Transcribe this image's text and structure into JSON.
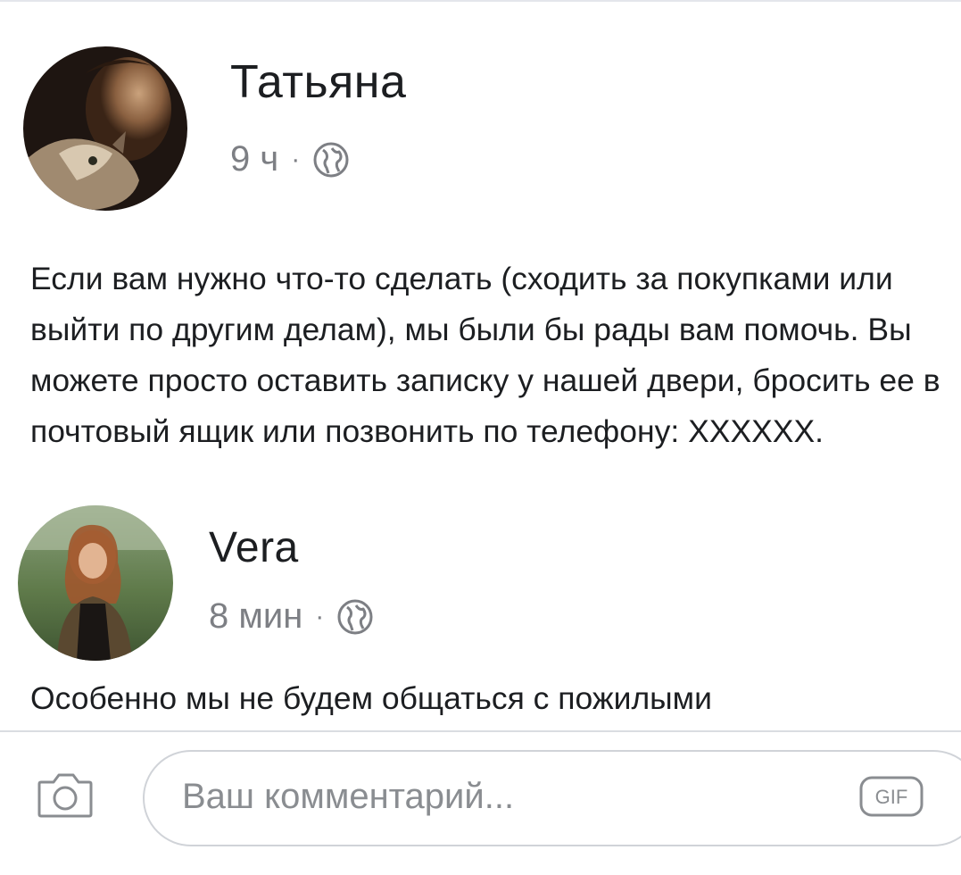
{
  "post": {
    "author": "Татьяна",
    "time": "9 ч",
    "separator": "·",
    "privacy_icon": "globe-icon",
    "text": "Если вам нужно что-то сделать (сходить за покупками или выйти по другим делам), мы были бы рады вам помочь. Вы можете просто оставить записку у нашей двери, бросить ее в почтовый ящик или позвонить по телефону: XXXXXX."
  },
  "comment": {
    "author": "Vera",
    "time": "8 мин",
    "separator": "·",
    "privacy_icon": "globe-icon",
    "text": "Особенно мы не будем общаться с пожилыми"
  },
  "composer": {
    "camera_icon": "camera-icon",
    "placeholder": "Ваш комментарий...",
    "gif_icon": "gif-icon",
    "gif_label": "GIF"
  },
  "colors": {
    "text": "#1c1e21",
    "meta": "#7d7f84",
    "divider": "#dadde1",
    "input_border": "#d0d3d8"
  }
}
